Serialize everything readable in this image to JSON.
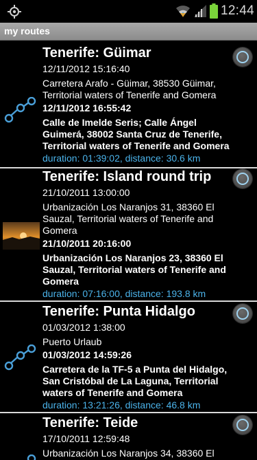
{
  "status_bar": {
    "time": "12:44",
    "icons": [
      "gps-icon",
      "wifi-icon",
      "signal-icon",
      "battery-icon"
    ]
  },
  "app": {
    "title": "my routes"
  },
  "colors": {
    "stats": "#4bb3ea",
    "separator": "#d9d9d9",
    "appbar": "#9a9a9a"
  },
  "routes": [
    {
      "title": "Tenerife: Güimar",
      "start_time": "12/11/2012 15:16:40",
      "start_address": "Carretera Arafo - Güimar, 38530 Güimar, Territorial waters of Tenerife and Gomera",
      "end_time": "12/11/2012 16:55:42",
      "end_address": "Calle de Imelde Seris; Calle Ángel Guimerá, 38002 Santa Cruz de Tenerife, Territorial waters of Tenerife and Gomera",
      "stats": "duration: 01:39:02, distance: 30.6 km",
      "thumbnail": "route-icon"
    },
    {
      "title": "Tenerife: Island round trip",
      "start_time": "21/10/2011 13:00:00",
      "start_address": "Urbanización Los Naranjos 31, 38360 El Sauzal, Territorial waters of Tenerife and Gomera",
      "end_time": "21/10/2011 20:16:00",
      "end_address": "Urbanización Los Naranjos 23, 38360 El Sauzal, Territorial waters of Tenerife and Gomera",
      "stats": "duration: 07:16:00, distance: 193.8 km",
      "thumbnail": "sunset-photo"
    },
    {
      "title": "Tenerife: Punta Hidalgo",
      "start_time": "01/03/2012 1:38:00",
      "start_address": "Puerto Urlaub",
      "end_time": "01/03/2012 14:59:26",
      "end_address": "Carretera de la TF-5 a Punta del Hidalgo, San Cristóbal de La Laguna, Territorial waters of Tenerife and Gomera",
      "stats": "duration: 13:21:26, distance: 46.8 km",
      "thumbnail": "route-icon"
    },
    {
      "title": "Tenerife: Teide",
      "start_time": "17/10/2011 12:59:48",
      "start_address": "Urbanización Los Naranjos 34, 38360 El",
      "thumbnail": "route-icon"
    }
  ]
}
